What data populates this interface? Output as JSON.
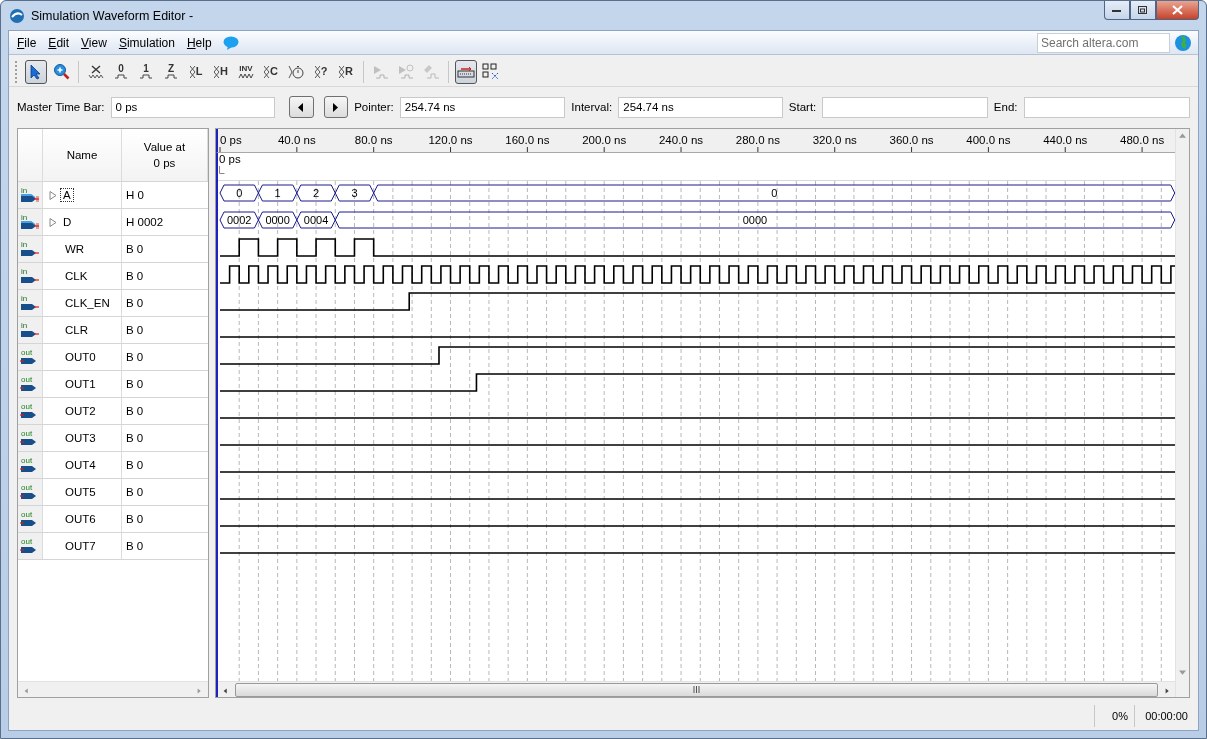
{
  "window": {
    "title": "Simulation Waveform Editor -"
  },
  "menu": [
    {
      "label": "File"
    },
    {
      "label": "Edit"
    },
    {
      "label": "View"
    },
    {
      "label": "Simulation"
    },
    {
      "label": "Help"
    }
  ],
  "search": {
    "placeholder": "Search altera.com"
  },
  "toolbar": [
    {
      "kind": "select",
      "selected": true
    },
    {
      "kind": "zoom",
      "selected": false
    },
    {
      "kind": "separator"
    },
    {
      "kind": "unknown",
      "selected": false
    },
    {
      "kind": "level",
      "label": "0",
      "selected": false
    },
    {
      "kind": "level",
      "label": "1",
      "selected": false
    },
    {
      "kind": "level",
      "label": "Z",
      "selected": false
    },
    {
      "kind": "cross",
      "label": "L",
      "selected": false
    },
    {
      "kind": "cross",
      "label": "H",
      "selected": false
    },
    {
      "kind": "invert",
      "label": "INV",
      "selected": false
    },
    {
      "kind": "cross",
      "label": "C",
      "selected": false
    },
    {
      "kind": "clock",
      "selected": false
    },
    {
      "kind": "cross",
      "label": "?",
      "selected": false
    },
    {
      "kind": "cross",
      "label": "R",
      "selected": false
    },
    {
      "kind": "separator"
    },
    {
      "kind": "run",
      "disabled": true,
      "selected": false
    },
    {
      "kind": "run-timing",
      "disabled": true,
      "selected": false
    },
    {
      "kind": "generate",
      "disabled": true,
      "selected": false
    },
    {
      "kind": "separator"
    },
    {
      "kind": "snap",
      "selected": true
    },
    {
      "kind": "grid",
      "selected": false
    }
  ],
  "time_bar": {
    "master_label": "Master Time Bar:",
    "master_value": "0 ps",
    "pointer_label": "Pointer:",
    "pointer_value": "254.74 ns",
    "interval_label": "Interval:",
    "interval_value": "254.74 ns",
    "start_label": "Start:",
    "end_label": "End:"
  },
  "signal_table": {
    "columns": [
      "Name",
      "Value at\n0 ps"
    ]
  },
  "ruler": {
    "ticks": [
      "0 ps",
      "40.0 ns",
      "80.0 ns",
      "120.0 ns",
      "160.0 ns",
      "200.0 ns",
      "240.0 ns",
      "280.0 ns",
      "320.0 ns",
      "360.0 ns",
      "400.0 ns",
      "440.0 ns",
      "480.0 ns"
    ],
    "marker": "0 ps"
  },
  "signals": [
    {
      "name": "A",
      "io": "in",
      "bus": true,
      "expanded": false,
      "selected": true,
      "value": "H 0",
      "segments": [
        "0",
        "1",
        "2",
        "3",
        "0"
      ]
    },
    {
      "name": "D",
      "io": "in",
      "bus": true,
      "expanded": false,
      "selected": false,
      "value": "H 0002",
      "segments": [
        "0002",
        "0000",
        "0004",
        "0000"
      ]
    },
    {
      "name": "WR",
      "io": "in",
      "bus": false,
      "selected": false,
      "value": "B 0"
    },
    {
      "name": "CLK",
      "io": "in",
      "bus": false,
      "selected": false,
      "value": "B 0"
    },
    {
      "name": "CLK_EN",
      "io": "in",
      "bus": false,
      "selected": false,
      "value": "B 0"
    },
    {
      "name": "CLR",
      "io": "in",
      "bus": false,
      "selected": false,
      "value": "B 0"
    },
    {
      "name": "OUT0",
      "io": "out",
      "bus": false,
      "selected": false,
      "value": "B 0"
    },
    {
      "name": "OUT1",
      "io": "out",
      "bus": false,
      "selected": false,
      "value": "B 0"
    },
    {
      "name": "OUT2",
      "io": "out",
      "bus": false,
      "selected": false,
      "value": "B 0"
    },
    {
      "name": "OUT3",
      "io": "out",
      "bus": false,
      "selected": false,
      "value": "B 0"
    },
    {
      "name": "OUT4",
      "io": "out",
      "bus": false,
      "selected": false,
      "value": "B 0"
    },
    {
      "name": "OUT5",
      "io": "out",
      "bus": false,
      "selected": false,
      "value": "B 0"
    },
    {
      "name": "OUT6",
      "io": "out",
      "bus": false,
      "selected": false,
      "value": "B 0"
    },
    {
      "name": "OUT7",
      "io": "out",
      "bus": false,
      "selected": false,
      "value": "B 0"
    }
  ],
  "status_bar": {
    "progress": "0%",
    "elapsed": "00:00:00"
  }
}
